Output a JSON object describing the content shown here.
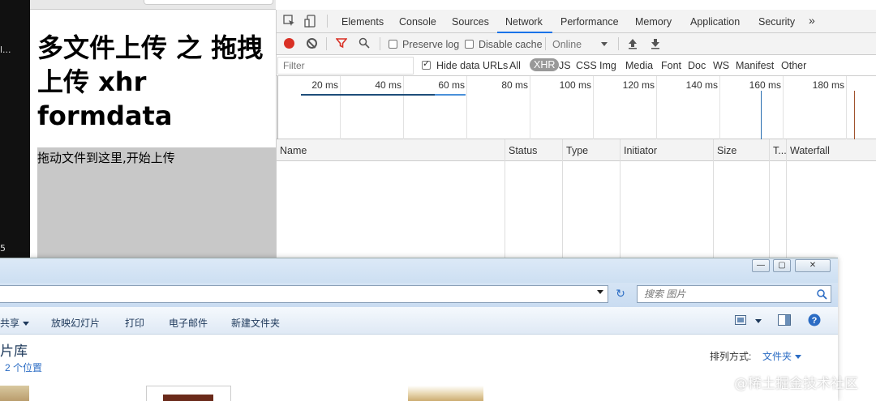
{
  "terminal": {
    "line1": "l...",
    "line2": "5"
  },
  "page": {
    "heading": "多文件上传 之 拖拽上传 xhr formdata",
    "dropzone_text": "拖动文件到这里,开始上传"
  },
  "devtools": {
    "tabs": [
      "Elements",
      "Console",
      "Sources",
      "Network",
      "Performance",
      "Memory",
      "Application",
      "Security",
      "»"
    ],
    "active_tab": "Network",
    "toolbar": {
      "preserve_log": "Preserve log",
      "disable_cache": "Disable cache",
      "throttle": "Online"
    },
    "filterbar": {
      "placeholder": "Filter",
      "hide_data_urls": "Hide data URLs",
      "types": [
        "All",
        "XHR",
        "JS",
        "CSS",
        "Img",
        "Media",
        "Font",
        "Doc",
        "WS",
        "Manifest",
        "Other"
      ],
      "active_type": "XHR"
    },
    "timeline_ticks": [
      "20 ms",
      "40 ms",
      "60 ms",
      "80 ms",
      "100 ms",
      "120 ms",
      "140 ms",
      "160 ms",
      "180 ms"
    ],
    "columns": [
      "Name",
      "Status",
      "Type",
      "Initiator",
      "Size",
      "T...",
      "Waterfall"
    ]
  },
  "explorer": {
    "search_placeholder": "搜索 图片",
    "commands": [
      "共享",
      "放映幻灯片",
      "打印",
      "电子邮件",
      "新建文件夹"
    ],
    "library_title": "片库",
    "library_locations": "2 个位置",
    "arrange_label": "排列方式:",
    "arrange_value": "文件夹",
    "window_buttons": {
      "minimize": "—",
      "maximize": "▢",
      "close": "✕"
    },
    "refresh": "↻"
  },
  "watermark": "@稀土掘金技术社区",
  "colors": {
    "record": "#d93025",
    "active_tab_underline": "#1a73e8",
    "dropzone": "#c8c8c8"
  }
}
